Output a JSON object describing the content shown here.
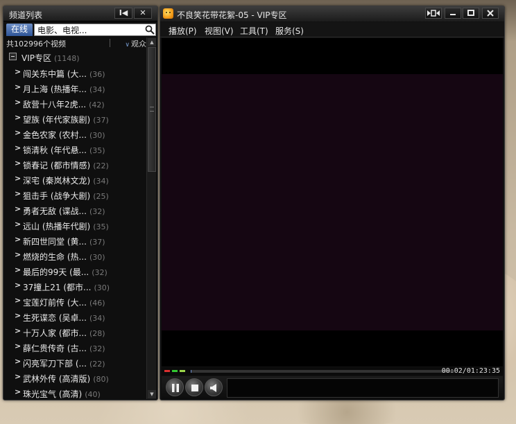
{
  "channel_panel": {
    "title": "频道列表",
    "btn_pin": "I◀",
    "btn_close": "✕",
    "tab_online": "在线",
    "search_value": "电影、电视...",
    "video_count": "共102996个视频",
    "sort_label": "观众",
    "root": {
      "label": "VIP专区",
      "count": "(1148)"
    },
    "items": [
      {
        "title": "闯关东中篇 (大...",
        "count": "(36)"
      },
      {
        "title": "月上海 (热播年...",
        "count": "(34)"
      },
      {
        "title": "敌营十八年2虎...",
        "count": "(42)"
      },
      {
        "title": "望族 (年代家族剧)",
        "count": "(37)"
      },
      {
        "title": "金色农家 (农村...",
        "count": "(30)"
      },
      {
        "title": "锁清秋 (年代悬...",
        "count": "(35)"
      },
      {
        "title": "锁春记 (都市情感)",
        "count": "(22)"
      },
      {
        "title": "深宅 (秦岚林文龙)",
        "count": "(34)"
      },
      {
        "title": "狙击手 (战争大剧)",
        "count": "(25)"
      },
      {
        "title": "勇者无敌 (谍战...",
        "count": "(32)"
      },
      {
        "title": "远山 (热播年代剧)",
        "count": "(35)"
      },
      {
        "title": "新四世同堂 (黄...",
        "count": "(37)"
      },
      {
        "title": "燃烧的生命 (热...",
        "count": "(30)"
      },
      {
        "title": "最后的99天 (最...",
        "count": "(32)"
      },
      {
        "title": "37撞上21 (都市...",
        "count": "(30)"
      },
      {
        "title": "宝莲灯前传 (大...",
        "count": "(46)"
      },
      {
        "title": "生死谍恋 (吴卓...",
        "count": "(34)"
      },
      {
        "title": "十万人家 (都市...",
        "count": "(28)"
      },
      {
        "title": "薛仁贵传奇 (古...",
        "count": "(32)"
      },
      {
        "title": "闪亮军刀下部 (...",
        "count": "(22)"
      },
      {
        "title": "武林外传 (高清版)",
        "count": "(80)"
      },
      {
        "title": "珠光宝气 (高清)",
        "count": "(40)"
      }
    ]
  },
  "player": {
    "title": "不良笑花带花絮-05 - VIP专区",
    "menus": [
      {
        "label": "播放(P)"
      },
      {
        "label": "视图(V)"
      },
      {
        "label": "工具(T)"
      },
      {
        "label": "服务(S)"
      }
    ],
    "time": "00:02/01:23:35",
    "progress_fraction": 0.0004
  },
  "colors": {
    "accent_tab": "#2f5597",
    "led_red": "#d93030",
    "led_green1": "#32c832",
    "led_green2": "#9bd64a"
  }
}
